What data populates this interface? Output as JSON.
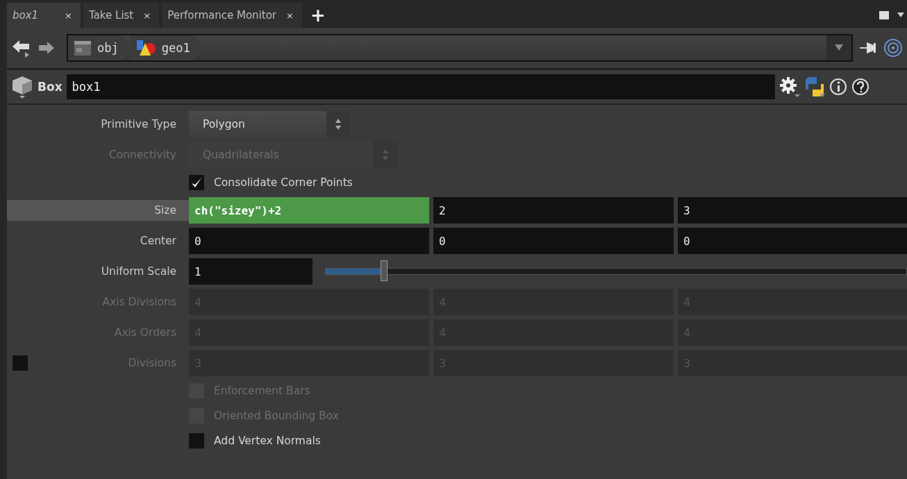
{
  "tabs": [
    {
      "label": "box1",
      "close": "×",
      "selected": true
    },
    {
      "label": "Take List",
      "close": "×",
      "selected": false
    },
    {
      "label": "Performance Monitor",
      "close": "×",
      "selected": false
    }
  ],
  "new_tab": "+",
  "path": [
    {
      "label": "obj",
      "kind": "network"
    },
    {
      "label": "geo1",
      "kind": "geometry"
    }
  ],
  "node": {
    "type": "Box",
    "name": "box1"
  },
  "params": [
    {
      "kind": "menu",
      "label": "Primitive Type",
      "value": "Polygon",
      "disabled": false,
      "highlighted": false
    },
    {
      "kind": "menu",
      "label": "Connectivity",
      "value": "Quadrilaterals",
      "disabled": true,
      "highlighted": false
    },
    {
      "kind": "toggle",
      "label": "Consolidate Corner Points",
      "checked": true,
      "disabled": false
    },
    {
      "kind": "vector",
      "label": "Size",
      "disabled": false,
      "highlighted": true,
      "fields": [
        {
          "value": "ch(\"sizey\")+2",
          "expression": true
        },
        {
          "value": "2",
          "expression": false
        },
        {
          "value": "3",
          "expression": false
        }
      ]
    },
    {
      "kind": "vector",
      "label": "Center",
      "disabled": false,
      "highlighted": false,
      "fields": [
        {
          "value": "0",
          "expression": false
        },
        {
          "value": "0",
          "expression": false
        },
        {
          "value": "0",
          "expression": false
        }
      ]
    },
    {
      "kind": "slider",
      "label": "Uniform Scale",
      "value": "1",
      "level": 0.1,
      "disabled": false,
      "highlighted": false
    },
    {
      "kind": "vector",
      "label": "Axis Divisions",
      "disabled": true,
      "highlighted": false,
      "fields": [
        {
          "value": "4",
          "expression": false
        },
        {
          "value": "4",
          "expression": false
        },
        {
          "value": "4",
          "expression": false
        }
      ]
    },
    {
      "kind": "vector",
      "label": "Axis Orders",
      "disabled": true,
      "highlighted": false,
      "fields": [
        {
          "value": "4",
          "expression": false
        },
        {
          "value": "4",
          "expression": false
        },
        {
          "value": "4",
          "expression": false
        }
      ]
    },
    {
      "kind": "vector",
      "label": "Divisions",
      "disabled": true,
      "highlighted": false,
      "enable_toggle": {
        "checked": false
      },
      "fields": [
        {
          "value": "3",
          "expression": false
        },
        {
          "value": "3",
          "expression": false
        },
        {
          "value": "3",
          "expression": false
        }
      ]
    },
    {
      "kind": "toggle",
      "label": "Enforcement Bars",
      "checked": false,
      "disabled": true
    },
    {
      "kind": "toggle",
      "label": "Oriented Bounding Box",
      "checked": false,
      "disabled": true
    },
    {
      "kind": "toggle",
      "label": "Add Vertex Normals",
      "checked": false,
      "disabled": false
    }
  ]
}
